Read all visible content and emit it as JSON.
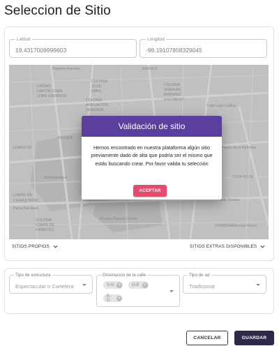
{
  "page": {
    "title": "Seleccion de Sitio"
  },
  "coordinates": {
    "latitude_label": "Latitud",
    "latitude_value": "19.4317009999603",
    "longitude_label": "Longitud",
    "longitude_value": "-99.19107858329045"
  },
  "map": {
    "labels": [
      "Panteón Francés",
      "JUANICO",
      "UNIDAD",
      "HABITACIONAL",
      "LOMA HERMOSA",
      "COLONIA",
      "10 DE",
      "ABRIL",
      "COLONIA",
      "AMPLIACIÓN",
      "GRANADA",
      "COLONIA",
      "ANAHUAC",
      "MARIANO",
      "ESCOBEDO",
      "BOSQUE",
      "Reforma Agua",
      "Calle Lago Caillou",
      "ZONA ROSA",
      "Paseo de la Reforma",
      "LOMAS DE",
      "CHAPULTEPEC",
      "Parca Barrilace",
      "COLONIA",
      "LOMAS DE",
      "VIRREYES",
      "Acuario Parque Urbano",
      "CONDESA",
      "Mercado Roma",
      "LOMAS DE",
      "Calle Sinaloa"
    ]
  },
  "dialog": {
    "title": "Validación de sitio",
    "message": "Hemos encontrado en nuestra plataforma algún sitio previamente dado de alta que podría ser el mismo que estás buscando crear. Por favor valida tu selección",
    "accept_label": "ACEPTAR"
  },
  "toggles": {
    "sitios_propios": "SITIOS PROPIOS",
    "sitios_extras": "SITIOS EXTRAS DISPONIBLES"
  },
  "filters": {
    "estructura": {
      "label": "Tipo de estructura",
      "value": "Espectacular o Cartelera"
    },
    "orientacion": {
      "label": "Orientación de la calle",
      "chips": [
        "S-N",
        "O-E",
        "E-O"
      ]
    },
    "tipo_ad": {
      "label": "Tipo de ad",
      "value": "Tradicional"
    }
  },
  "actions": {
    "cancel_label": "CANCELAR",
    "save_label": "GUARDAR"
  },
  "colors": {
    "dialog_header": "#5b3f9e",
    "accept": "#e84a6e",
    "save": "#2e2948"
  }
}
